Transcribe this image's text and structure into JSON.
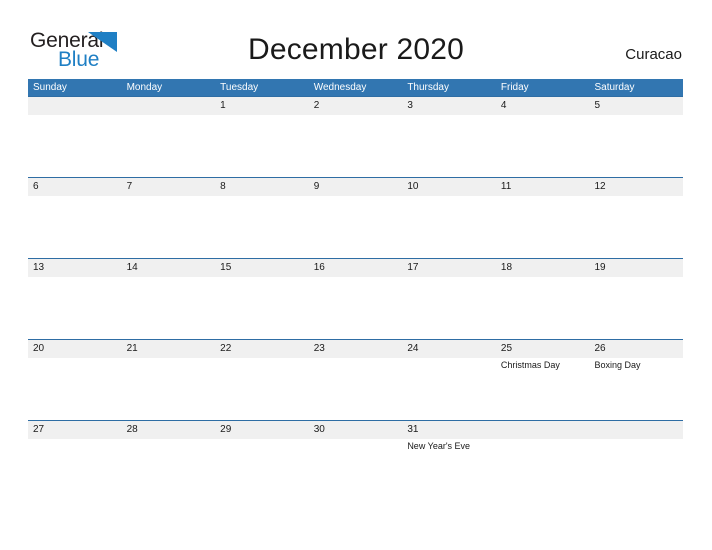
{
  "brand": {
    "name_part1": "General",
    "name_part2": "Blue",
    "flag_icon": "blue-flag-triangle",
    "color_dark": "#231f20",
    "color_blue": "#1f7fc4"
  },
  "header": {
    "title": "December 2020",
    "locale": "Curacao"
  },
  "theme": {
    "header_blue": "#3276b1",
    "row_border_blue": "#2e6da4",
    "band_gray": "#f0f0f0",
    "text_dark": "#1a1a1a"
  },
  "calendar": {
    "month": "December",
    "year": "2020",
    "weekday_headers": [
      "Sunday",
      "Monday",
      "Tuesday",
      "Wednesday",
      "Thursday",
      "Friday",
      "Saturday"
    ],
    "weeks": [
      [
        {
          "date": "",
          "event": ""
        },
        {
          "date": "",
          "event": ""
        },
        {
          "date": "1",
          "event": ""
        },
        {
          "date": "2",
          "event": ""
        },
        {
          "date": "3",
          "event": ""
        },
        {
          "date": "4",
          "event": ""
        },
        {
          "date": "5",
          "event": ""
        }
      ],
      [
        {
          "date": "6",
          "event": ""
        },
        {
          "date": "7",
          "event": ""
        },
        {
          "date": "8",
          "event": ""
        },
        {
          "date": "9",
          "event": ""
        },
        {
          "date": "10",
          "event": ""
        },
        {
          "date": "11",
          "event": ""
        },
        {
          "date": "12",
          "event": ""
        }
      ],
      [
        {
          "date": "13",
          "event": ""
        },
        {
          "date": "14",
          "event": ""
        },
        {
          "date": "15",
          "event": ""
        },
        {
          "date": "16",
          "event": ""
        },
        {
          "date": "17",
          "event": ""
        },
        {
          "date": "18",
          "event": ""
        },
        {
          "date": "19",
          "event": ""
        }
      ],
      [
        {
          "date": "20",
          "event": ""
        },
        {
          "date": "21",
          "event": ""
        },
        {
          "date": "22",
          "event": ""
        },
        {
          "date": "23",
          "event": ""
        },
        {
          "date": "24",
          "event": ""
        },
        {
          "date": "25",
          "event": "Christmas Day"
        },
        {
          "date": "26",
          "event": "Boxing Day"
        }
      ],
      [
        {
          "date": "27",
          "event": ""
        },
        {
          "date": "28",
          "event": ""
        },
        {
          "date": "29",
          "event": ""
        },
        {
          "date": "30",
          "event": ""
        },
        {
          "date": "31",
          "event": "New Year's Eve"
        },
        {
          "date": "",
          "event": ""
        },
        {
          "date": "",
          "event": ""
        }
      ]
    ]
  }
}
